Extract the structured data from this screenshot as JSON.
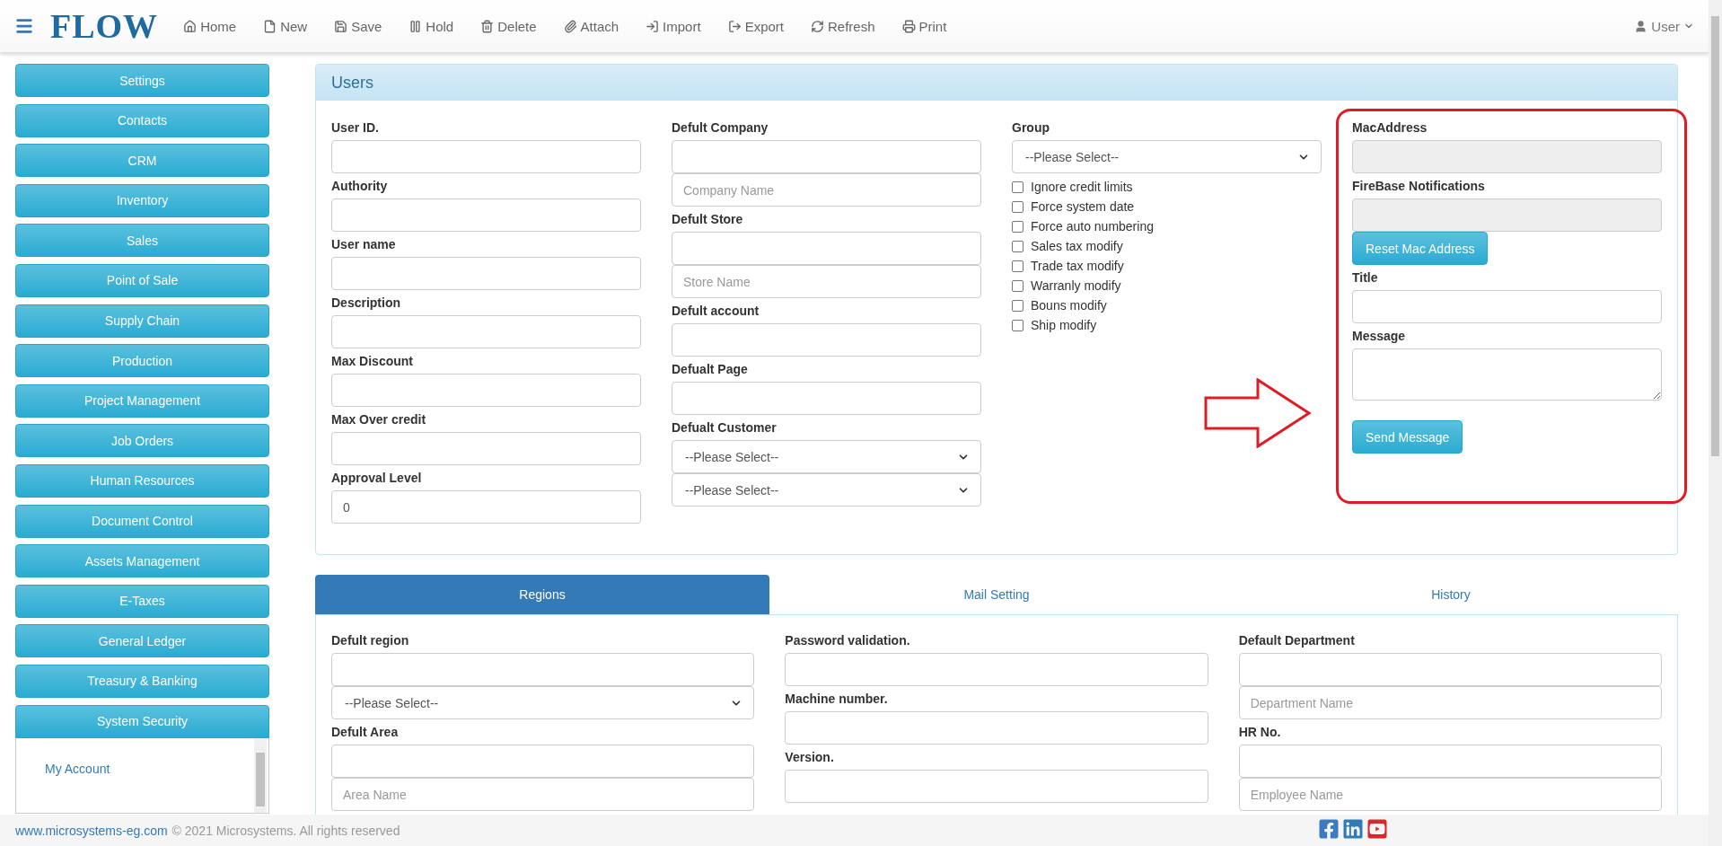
{
  "topbar": {
    "logo": "FLOW",
    "actions": [
      {
        "label": "Home"
      },
      {
        "label": "New"
      },
      {
        "label": "Save"
      },
      {
        "label": "Hold"
      },
      {
        "label": "Delete"
      },
      {
        "label": "Attach"
      },
      {
        "label": "Import"
      },
      {
        "label": "Export"
      },
      {
        "label": "Refresh"
      },
      {
        "label": "Print"
      }
    ],
    "user": "User"
  },
  "sidebar": {
    "items": [
      {
        "label": "Settings",
        "expanded": false
      },
      {
        "label": "Contacts",
        "expanded": false
      },
      {
        "label": "CRM",
        "expanded": false
      },
      {
        "label": "Inventory",
        "expanded": false
      },
      {
        "label": "Sales",
        "expanded": false
      },
      {
        "label": "Point of Sale",
        "expanded": false
      },
      {
        "label": "Supply Chain",
        "expanded": false
      },
      {
        "label": "Production",
        "expanded": false
      },
      {
        "label": "Project Management",
        "expanded": false
      },
      {
        "label": "Job Orders",
        "expanded": false
      },
      {
        "label": "Human Resources",
        "expanded": false
      },
      {
        "label": "Document Control",
        "expanded": false
      },
      {
        "label": "Assets Management",
        "expanded": false
      },
      {
        "label": "E-Taxes",
        "expanded": false
      },
      {
        "label": "General Ledger",
        "expanded": false
      },
      {
        "label": "Treasury & Banking",
        "expanded": false
      },
      {
        "label": "System Security",
        "expanded": true,
        "children": [
          {
            "label": "My Account"
          }
        ]
      }
    ]
  },
  "form": {
    "title": "Users",
    "columns": [
      [
        {
          "kind": "label",
          "text": "User ID."
        },
        {
          "kind": "input"
        },
        {
          "kind": "label",
          "text": "Authority"
        },
        {
          "kind": "input"
        },
        {
          "kind": "label",
          "text": "User name"
        },
        {
          "kind": "input"
        },
        {
          "kind": "label",
          "text": "Description"
        },
        {
          "kind": "input"
        },
        {
          "kind": "label",
          "text": "Max Discount"
        },
        {
          "kind": "input"
        },
        {
          "kind": "label",
          "text": "Max Over credit"
        },
        {
          "kind": "input"
        },
        {
          "kind": "label",
          "text": "Approval Level"
        },
        {
          "kind": "input",
          "value": "0"
        }
      ],
      [
        {
          "kind": "label",
          "text": "Defult Company"
        },
        {
          "kind": "input"
        },
        {
          "kind": "input",
          "placeholder": "Company Name"
        },
        {
          "kind": "label",
          "text": "Defult Store"
        },
        {
          "kind": "input"
        },
        {
          "kind": "input",
          "placeholder": "Store Name"
        },
        {
          "kind": "label",
          "text": "Defult account"
        },
        {
          "kind": "input"
        },
        {
          "kind": "label",
          "text": "Defualt Page"
        },
        {
          "kind": "input"
        },
        {
          "kind": "label",
          "text": "Defualt Customer"
        },
        {
          "kind": "select",
          "value": "--Please Select--"
        },
        {
          "kind": "select",
          "value": "--Please Select--"
        }
      ],
      [
        {
          "kind": "label",
          "text": "Group"
        },
        {
          "kind": "select",
          "value": "--Please Select--"
        },
        {
          "kind": "checkbox",
          "text": "Ignore credit limits",
          "checked": false
        },
        {
          "kind": "checkbox",
          "text": "Force system date",
          "checked": false
        },
        {
          "kind": "checkbox",
          "text": "Force auto numbering",
          "checked": false
        },
        {
          "kind": "checkbox",
          "text": "Sales tax modify",
          "checked": false
        },
        {
          "kind": "checkbox",
          "text": "Trade tax modify",
          "checked": false
        },
        {
          "kind": "checkbox",
          "text": "Warranly modify",
          "checked": false
        },
        {
          "kind": "checkbox",
          "text": "Bouns modify",
          "checked": false
        },
        {
          "kind": "checkbox",
          "text": "Ship modify",
          "checked": false
        }
      ],
      [
        {
          "kind": "label",
          "text": "MacAddress"
        },
        {
          "kind": "input",
          "disabled": true
        },
        {
          "kind": "label",
          "text": "FireBase Notifications"
        },
        {
          "kind": "input",
          "disabled": true
        },
        {
          "kind": "button",
          "text": "Reset Mac Address"
        },
        {
          "kind": "label",
          "text": "Title"
        },
        {
          "kind": "input"
        },
        {
          "kind": "label",
          "text": "Message"
        },
        {
          "kind": "textarea"
        },
        {
          "kind": "button",
          "text": "Send Message"
        }
      ]
    ]
  },
  "tabs": [
    {
      "label": "Regions",
      "selected": true
    },
    {
      "label": "Mail Setting",
      "selected": false
    },
    {
      "label": "History",
      "selected": false
    }
  ],
  "regions": {
    "columns": [
      [
        {
          "kind": "label",
          "text": "Defult region"
        },
        {
          "kind": "input"
        },
        {
          "kind": "select",
          "value": "--Please Select--"
        },
        {
          "kind": "label",
          "text": "Defult Area"
        },
        {
          "kind": "input"
        },
        {
          "kind": "input",
          "placeholder": "Area Name"
        }
      ],
      [
        {
          "kind": "label",
          "text": "Password validation."
        },
        {
          "kind": "input"
        },
        {
          "kind": "label",
          "text": "Machine number."
        },
        {
          "kind": "input"
        },
        {
          "kind": "label",
          "text": "Version."
        },
        {
          "kind": "input"
        }
      ],
      [
        {
          "kind": "label",
          "text": "Default Department"
        },
        {
          "kind": "input"
        },
        {
          "kind": "input",
          "placeholder": "Department Name"
        },
        {
          "kind": "label",
          "text": "HR No."
        },
        {
          "kind": "input"
        },
        {
          "kind": "input",
          "placeholder": "Employee Name"
        }
      ]
    ]
  },
  "footer": {
    "link": "www.microsystems-eg.com",
    "text": "© 2021 Microsystems. All rights reserved"
  }
}
